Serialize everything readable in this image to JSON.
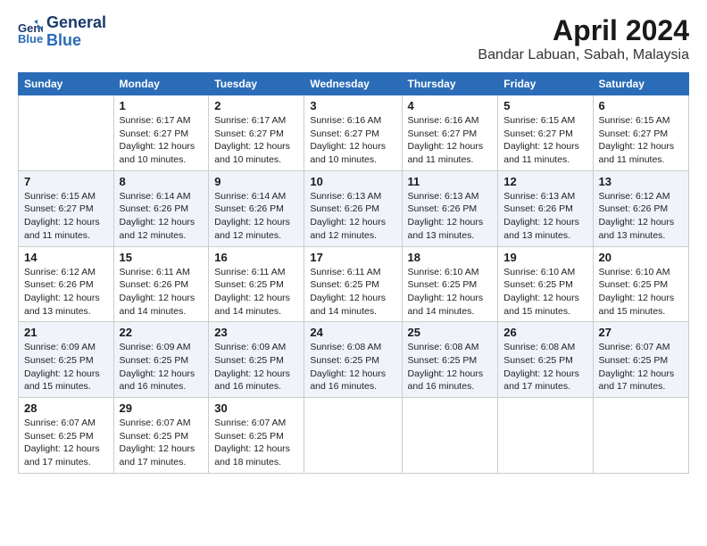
{
  "logo": {
    "line1": "General",
    "line2": "Blue"
  },
  "title": "April 2024",
  "subtitle": "Bandar Labuan, Sabah, Malaysia",
  "weekdays": [
    "Sunday",
    "Monday",
    "Tuesday",
    "Wednesday",
    "Thursday",
    "Friday",
    "Saturday"
  ],
  "weeks": [
    [
      {
        "day": "",
        "info": ""
      },
      {
        "day": "1",
        "info": "Sunrise: 6:17 AM\nSunset: 6:27 PM\nDaylight: 12 hours\nand 10 minutes."
      },
      {
        "day": "2",
        "info": "Sunrise: 6:17 AM\nSunset: 6:27 PM\nDaylight: 12 hours\nand 10 minutes."
      },
      {
        "day": "3",
        "info": "Sunrise: 6:16 AM\nSunset: 6:27 PM\nDaylight: 12 hours\nand 10 minutes."
      },
      {
        "day": "4",
        "info": "Sunrise: 6:16 AM\nSunset: 6:27 PM\nDaylight: 12 hours\nand 11 minutes."
      },
      {
        "day": "5",
        "info": "Sunrise: 6:15 AM\nSunset: 6:27 PM\nDaylight: 12 hours\nand 11 minutes."
      },
      {
        "day": "6",
        "info": "Sunrise: 6:15 AM\nSunset: 6:27 PM\nDaylight: 12 hours\nand 11 minutes."
      }
    ],
    [
      {
        "day": "7",
        "info": "Sunrise: 6:15 AM\nSunset: 6:27 PM\nDaylight: 12 hours\nand 11 minutes."
      },
      {
        "day": "8",
        "info": "Sunrise: 6:14 AM\nSunset: 6:26 PM\nDaylight: 12 hours\nand 12 minutes."
      },
      {
        "day": "9",
        "info": "Sunrise: 6:14 AM\nSunset: 6:26 PM\nDaylight: 12 hours\nand 12 minutes."
      },
      {
        "day": "10",
        "info": "Sunrise: 6:13 AM\nSunset: 6:26 PM\nDaylight: 12 hours\nand 12 minutes."
      },
      {
        "day": "11",
        "info": "Sunrise: 6:13 AM\nSunset: 6:26 PM\nDaylight: 12 hours\nand 13 minutes."
      },
      {
        "day": "12",
        "info": "Sunrise: 6:13 AM\nSunset: 6:26 PM\nDaylight: 12 hours\nand 13 minutes."
      },
      {
        "day": "13",
        "info": "Sunrise: 6:12 AM\nSunset: 6:26 PM\nDaylight: 12 hours\nand 13 minutes."
      }
    ],
    [
      {
        "day": "14",
        "info": "Sunrise: 6:12 AM\nSunset: 6:26 PM\nDaylight: 12 hours\nand 13 minutes."
      },
      {
        "day": "15",
        "info": "Sunrise: 6:11 AM\nSunset: 6:26 PM\nDaylight: 12 hours\nand 14 minutes."
      },
      {
        "day": "16",
        "info": "Sunrise: 6:11 AM\nSunset: 6:25 PM\nDaylight: 12 hours\nand 14 minutes."
      },
      {
        "day": "17",
        "info": "Sunrise: 6:11 AM\nSunset: 6:25 PM\nDaylight: 12 hours\nand 14 minutes."
      },
      {
        "day": "18",
        "info": "Sunrise: 6:10 AM\nSunset: 6:25 PM\nDaylight: 12 hours\nand 14 minutes."
      },
      {
        "day": "19",
        "info": "Sunrise: 6:10 AM\nSunset: 6:25 PM\nDaylight: 12 hours\nand 15 minutes."
      },
      {
        "day": "20",
        "info": "Sunrise: 6:10 AM\nSunset: 6:25 PM\nDaylight: 12 hours\nand 15 minutes."
      }
    ],
    [
      {
        "day": "21",
        "info": "Sunrise: 6:09 AM\nSunset: 6:25 PM\nDaylight: 12 hours\nand 15 minutes."
      },
      {
        "day": "22",
        "info": "Sunrise: 6:09 AM\nSunset: 6:25 PM\nDaylight: 12 hours\nand 16 minutes."
      },
      {
        "day": "23",
        "info": "Sunrise: 6:09 AM\nSunset: 6:25 PM\nDaylight: 12 hours\nand 16 minutes."
      },
      {
        "day": "24",
        "info": "Sunrise: 6:08 AM\nSunset: 6:25 PM\nDaylight: 12 hours\nand 16 minutes."
      },
      {
        "day": "25",
        "info": "Sunrise: 6:08 AM\nSunset: 6:25 PM\nDaylight: 12 hours\nand 16 minutes."
      },
      {
        "day": "26",
        "info": "Sunrise: 6:08 AM\nSunset: 6:25 PM\nDaylight: 12 hours\nand 17 minutes."
      },
      {
        "day": "27",
        "info": "Sunrise: 6:07 AM\nSunset: 6:25 PM\nDaylight: 12 hours\nand 17 minutes."
      }
    ],
    [
      {
        "day": "28",
        "info": "Sunrise: 6:07 AM\nSunset: 6:25 PM\nDaylight: 12 hours\nand 17 minutes."
      },
      {
        "day": "29",
        "info": "Sunrise: 6:07 AM\nSunset: 6:25 PM\nDaylight: 12 hours\nand 17 minutes."
      },
      {
        "day": "30",
        "info": "Sunrise: 6:07 AM\nSunset: 6:25 PM\nDaylight: 12 hours\nand 18 minutes."
      },
      {
        "day": "",
        "info": ""
      },
      {
        "day": "",
        "info": ""
      },
      {
        "day": "",
        "info": ""
      },
      {
        "day": "",
        "info": ""
      }
    ]
  ]
}
